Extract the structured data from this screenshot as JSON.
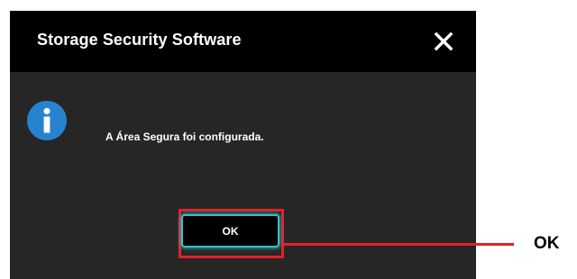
{
  "dialog": {
    "title": "Storage Security Software",
    "close_icon": "close-icon",
    "info_icon": "info-icon",
    "message": "A Área Segura foi configurada.",
    "ok_label": "OK"
  },
  "annotation": {
    "label": "OK",
    "highlight_color": "#e3202a"
  },
  "colors": {
    "titlebar": "#000000",
    "body": "#262626",
    "button_glow": "#2fc3c8",
    "info_blue": "#2783cf"
  }
}
